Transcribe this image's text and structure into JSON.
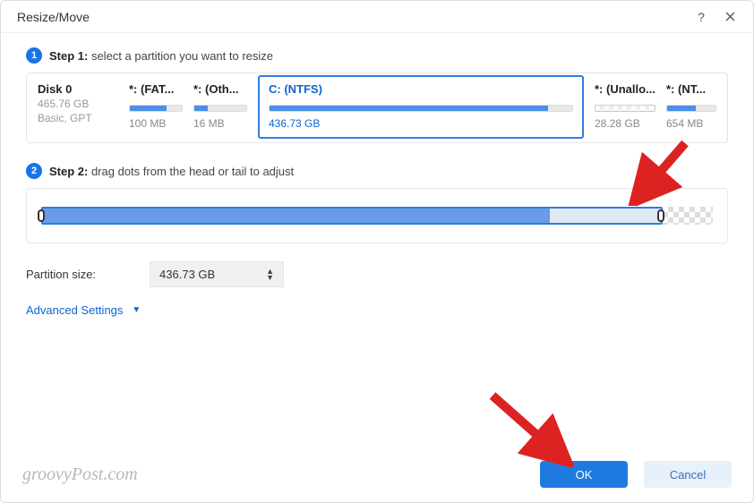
{
  "window": {
    "title": "Resize/Move"
  },
  "step1": {
    "label_strong": "Step 1:",
    "label_rest": " select a partition you want to resize"
  },
  "disk": {
    "name": "Disk 0",
    "capacity": "465.76 GB",
    "type_line": "Basic, GPT"
  },
  "partitions": {
    "fat": {
      "label": "*: (FAT...",
      "size": "100 MB"
    },
    "oth": {
      "label": "*: (Oth...",
      "size": "16 MB"
    },
    "c": {
      "label": "C: (NTFS)",
      "size": "436.73 GB"
    },
    "unalloc": {
      "label": "*: (Unallo...",
      "size": "28.28 GB"
    },
    "nt": {
      "label": "*: (NT...",
      "size": "654 MB"
    }
  },
  "step2": {
    "label_strong": "Step 2:",
    "label_rest": " drag dots from the head or tail to adjust"
  },
  "partition_size": {
    "label": "Partition size:",
    "value": "436.73 GB"
  },
  "advanced": {
    "label": "Advanced Settings"
  },
  "buttons": {
    "ok": "OK",
    "cancel": "Cancel"
  },
  "watermark": "groovyPost.com"
}
